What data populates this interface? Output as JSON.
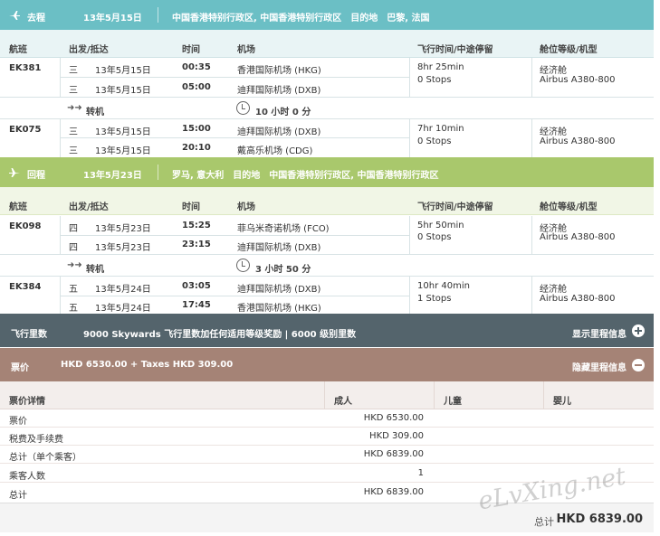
{
  "outbound": {
    "label": "去程",
    "date": "13年5月15日",
    "route": "中国香港特别行政区, 中国香港特别行政区　目的地　巴黎, 法国",
    "headers": [
      "航班",
      "出发/抵达",
      "时间",
      "机场",
      "飞行时间/中途停留",
      "舱位等级/机型"
    ],
    "flights": [
      {
        "flight": "EK381",
        "legs": [
          {
            "day": "三",
            "date": "13年5月15日",
            "time": "00:35",
            "airport": "香港国际机场 (HKG)"
          },
          {
            "day": "三",
            "date": "13年5月15日",
            "time": "05:00",
            "airport": "迪拜国际机场 (DXB)"
          }
        ],
        "duration": "8hr 25min",
        "stops": "0 Stops",
        "cabin": "经济舱",
        "aircraft": "Airbus A380-800"
      },
      {
        "flight": "EK075",
        "legs": [
          {
            "day": "三",
            "date": "13年5月15日",
            "time": "15:00",
            "airport": "迪拜国际机场 (DXB)"
          },
          {
            "day": "三",
            "date": "13年5月15日",
            "time": "20:10",
            "airport": "戴高乐机场 (CDG)"
          }
        ],
        "duration": "7hr 10min",
        "stops": "0 Stops",
        "cabin": "经济舱",
        "aircraft": "Airbus A380-800"
      }
    ],
    "connection": {
      "label": "转机",
      "duration": "10 小时 0 分"
    }
  },
  "inbound": {
    "label": "回程",
    "date": "13年5月23日",
    "route": "罗马, 意大利　目的地　中国香港特别行政区, 中国香港特别行政区",
    "headers": [
      "航班",
      "出发/抵达",
      "时间",
      "机场",
      "飞行时间/中途停留",
      "舱位等级/机型"
    ],
    "flights": [
      {
        "flight": "EK098",
        "legs": [
          {
            "day": "四",
            "date": "13年5月23日",
            "time": "15:25",
            "airport": "菲乌米奇诺机场 (FCO)"
          },
          {
            "day": "四",
            "date": "13年5月23日",
            "time": "23:15",
            "airport": "迪拜国际机场 (DXB)"
          }
        ],
        "duration": "5hr 50min",
        "stops": "0 Stops",
        "cabin": "经济舱",
        "aircraft": "Airbus A380-800"
      },
      {
        "flight": "EK384",
        "legs": [
          {
            "day": "五",
            "date": "13年5月24日",
            "time": "03:05",
            "airport": "迪拜国际机场 (DXB)"
          },
          {
            "day": "五",
            "date": "13年5月24日",
            "time": "17:45",
            "airport": "香港国际机场 (HKG)"
          }
        ],
        "duration": "10hr 40min",
        "stops": "1 Stops",
        "cabin": "经济舱",
        "aircraft": "Airbus A380-800"
      }
    ],
    "connection": {
      "label": "转机",
      "duration": "3 小时 50 分"
    }
  },
  "miles": {
    "title": "飞行里数",
    "detail": "9000 Skywards 飞行里数加任何适用等级奖励 | 6000 级别里数",
    "action": "显示里程信息"
  },
  "fare": {
    "title": "票价",
    "summary": "HKD 6530.00 + Taxes HKD 309.00",
    "action": "隐藏里程信息",
    "headers": [
      "票价详情",
      "成人",
      "儿童",
      "婴儿"
    ],
    "rows": [
      {
        "label": "票价",
        "adult": "HKD 6530.00"
      },
      {
        "label": "税费及手续费",
        "adult": "HKD 309.00"
      },
      {
        "label": "总计（单个乘客）",
        "adult": "HKD 6839.00"
      },
      {
        "label": "乘客人数",
        "adult": "1"
      },
      {
        "label": "总计",
        "adult": "HKD 6839.00"
      }
    ]
  },
  "total": {
    "label": "总计",
    "value": "HKD 6839.00"
  },
  "watermark": "eLvXing.net",
  "colors": {
    "outbound": "#6bbfc5",
    "inbound": "#a9c86c",
    "miles": "#54646c",
    "fare": "#a58376"
  }
}
